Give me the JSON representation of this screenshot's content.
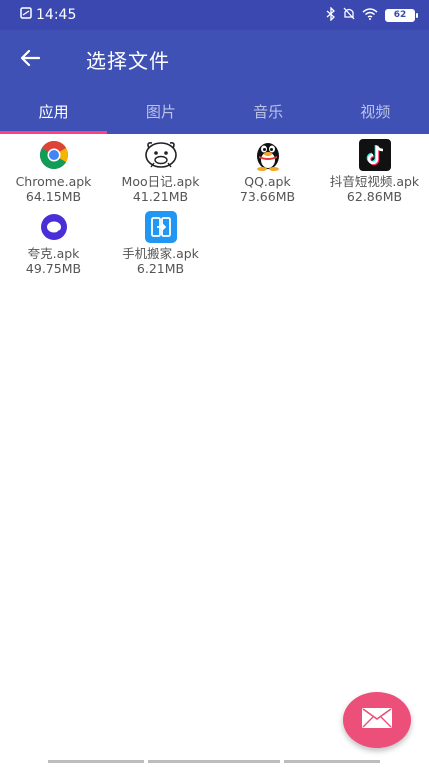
{
  "status_bar": {
    "time": "14:45",
    "battery": "62"
  },
  "app_bar": {
    "back_icon": "arrow-left-icon",
    "title": "选择文件"
  },
  "tabs": [
    {
      "label": "应用",
      "active": true
    },
    {
      "label": "图片",
      "active": false
    },
    {
      "label": "音乐",
      "active": false
    },
    {
      "label": "视频",
      "active": false
    }
  ],
  "files": [
    {
      "name": "Chrome.apk",
      "size": "64.15MB",
      "icon": "chrome-icon"
    },
    {
      "name": "Moo日记.apk",
      "size": "41.21MB",
      "icon": "moo-diary-icon"
    },
    {
      "name": "QQ.apk",
      "size": "73.66MB",
      "icon": "qq-penguin-icon"
    },
    {
      "name": "抖音短视频.apk",
      "size": "62.86MB",
      "icon": "tiktok-icon"
    },
    {
      "name": "夸克.apk",
      "size": "49.75MB",
      "icon": "quark-icon"
    },
    {
      "name": "手机搬家.apk",
      "size": "6.21MB",
      "icon": "phone-clone-icon"
    }
  ],
  "fab": {
    "icon": "mail-icon"
  },
  "colors": {
    "primary": "#3f51b5",
    "status_bar": "#3b48b0",
    "accent": "#ff4081",
    "fab": "#ec4f7a"
  }
}
